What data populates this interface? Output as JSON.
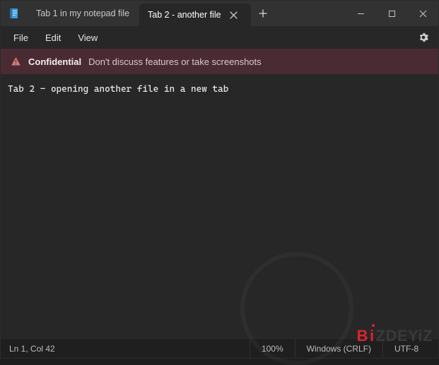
{
  "tabs": {
    "items": [
      {
        "label": "Tab 1 in my notepad file",
        "active": false
      },
      {
        "label": "Tab 2 - another file",
        "active": true
      }
    ]
  },
  "menu": {
    "file": "File",
    "edit": "Edit",
    "view": "View"
  },
  "banner": {
    "caption": "Confidential",
    "message": "Don't discuss features or take screenshots"
  },
  "editor": {
    "content": "Tab 2 - opening another file in a new tab"
  },
  "status": {
    "position": "Ln 1, Col 42",
    "zoom": "100%",
    "lineending": "Windows (CRLF)",
    "encoding": "UTF-8"
  },
  "watermark": {
    "brand_b": "B",
    "brand_i": "i",
    "brand_rest": "ZDEYiZ"
  }
}
